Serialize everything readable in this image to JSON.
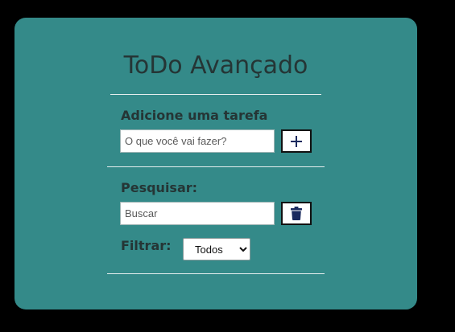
{
  "app": {
    "title": "ToDo Avançado"
  },
  "add_task": {
    "label": "Adicione uma tarefa",
    "input_placeholder": "O que você vai fazer?",
    "input_value": "",
    "button_icon": "plus-icon"
  },
  "search": {
    "label": "Pesquisar:",
    "input_placeholder": "Buscar",
    "input_value": "",
    "button_icon": "trash-icon"
  },
  "filter": {
    "label": "Filtrar:",
    "selected": "Todos"
  },
  "colors": {
    "page_background": "#000000",
    "card_background": "#348a89",
    "text": "#253535",
    "icon": "#1a2a5e"
  }
}
